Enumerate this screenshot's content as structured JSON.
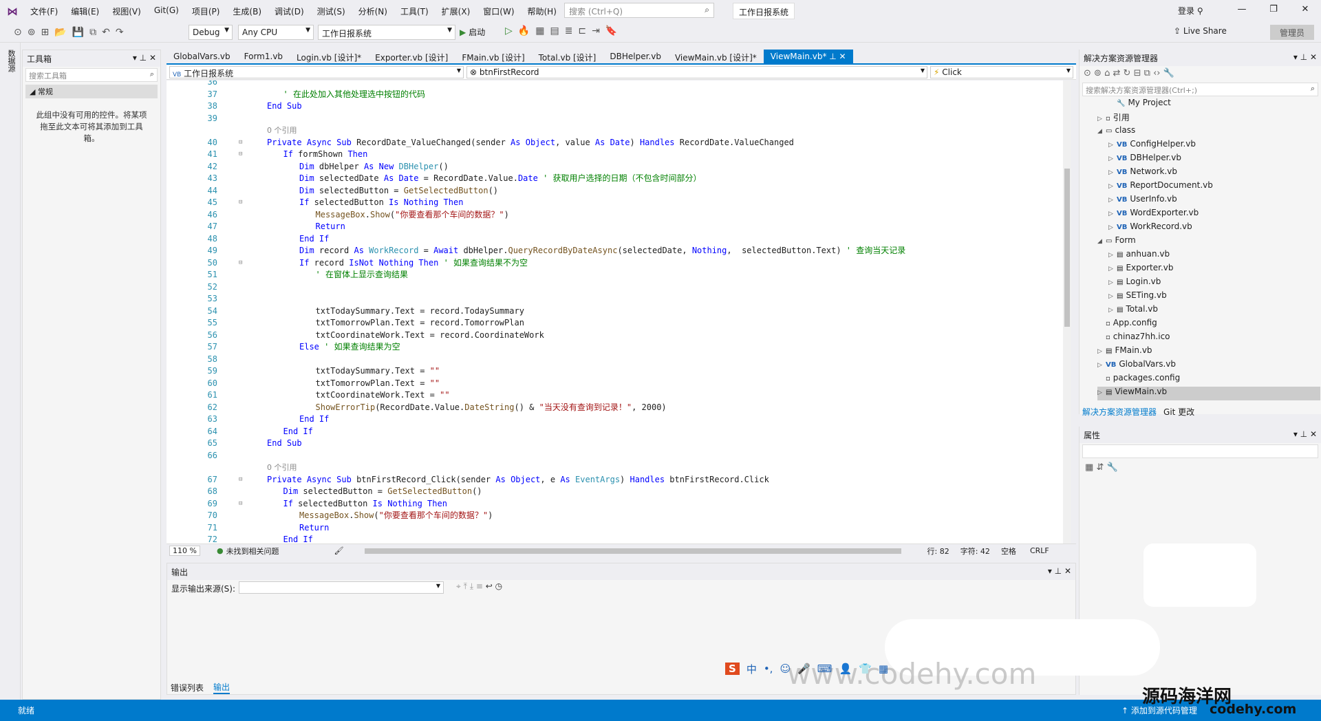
{
  "menubar": {
    "items": [
      "文件(F)",
      "编辑(E)",
      "视图(V)",
      "Git(G)",
      "项目(P)",
      "生成(B)",
      "调试(D)",
      "测试(S)",
      "分析(N)",
      "工具(T)",
      "扩展(X)",
      "窗口(W)",
      "帮助(H)"
    ],
    "search_placeholder": "搜索 (Ctrl+Q)",
    "app_title": "工作日报系统",
    "login": "登录"
  },
  "toolbar": {
    "config": "Debug",
    "platform": "Any CPU",
    "project": "工作日报系统",
    "start": "启动",
    "liveshare": "Live Share",
    "admin": "管理员"
  },
  "leftstrip": {
    "label": "数据源"
  },
  "toolbox": {
    "title": "工具箱",
    "search": "搜索工具箱",
    "group": "常规",
    "empty": "此组中没有可用的控件。将某项拖至此文本可将其添加到工具箱。"
  },
  "tabs": [
    "GlobalVars.vb",
    "Form1.vb",
    "Login.vb [设计]*",
    "Exporter.vb [设计]",
    "FMain.vb [设计]",
    "Total.vb [设计]",
    "DBHelper.vb",
    "ViewMain.vb [设计]*",
    "ViewMain.vb*"
  ],
  "navbar": {
    "project": "工作日报系统",
    "object": "btnFirstRecord",
    "event": "Click"
  },
  "code": [
    {
      "n": "36",
      "t": ""
    },
    {
      "n": "37",
      "t": "' 在此处加入其他处理选中按钮的代码",
      "cls": "cm",
      "indent": 2
    },
    {
      "n": "38",
      "t": "End Sub",
      "cls": "kw",
      "indent": 1
    },
    {
      "n": "39",
      "t": ""
    },
    {
      "ref": "0 个引用",
      "indent": 1
    },
    {
      "n": "40",
      "t": "Private Async Sub RecordDate_ValueChanged(sender As Object, value As Date) Handles RecordDate.ValueChanged",
      "indent": 1,
      "fold": true
    },
    {
      "n": "41",
      "t": "If formShown Then",
      "indent": 2,
      "fold": true
    },
    {
      "n": "42",
      "t": "Dim dbHelper As New DBHelper()",
      "indent": 3
    },
    {
      "n": "43",
      "t": "Dim selectedDate As Date = RecordDate.Value.Date ' 获取用户选择的日期（不包含时间部分）",
      "indent": 3
    },
    {
      "n": "44",
      "t": "Dim selectedButton = GetSelectedButton()",
      "indent": 3
    },
    {
      "n": "45",
      "t": "If selectedButton Is Nothing Then",
      "indent": 3,
      "fold": true
    },
    {
      "n": "46",
      "t": "MessageBox.Show(\"你要查看那个车间的数据？\")",
      "indent": 4
    },
    {
      "n": "47",
      "t": "Return",
      "indent": 4
    },
    {
      "n": "48",
      "t": "End If",
      "indent": 3
    },
    {
      "n": "49",
      "t": "Dim record As WorkRecord = Await dbHelper.QueryRecordByDateAsync(selectedDate, Nothing,  selectedButton.Text) ' 查询当天记录",
      "indent": 3
    },
    {
      "n": "50",
      "t": "If record IsNot Nothing Then ' 如果查询结果不为空",
      "indent": 3,
      "fold": true
    },
    {
      "n": "51",
      "t": "' 在窗体上显示查询结果",
      "cls": "cm",
      "indent": 4
    },
    {
      "n": "52",
      "t": ""
    },
    {
      "n": "53",
      "t": ""
    },
    {
      "n": "54",
      "t": "txtTodaySummary.Text = record.TodaySummary",
      "indent": 4
    },
    {
      "n": "55",
      "t": "txtTomorrowPlan.Text = record.TomorrowPlan",
      "indent": 4
    },
    {
      "n": "56",
      "t": "txtCoordinateWork.Text = record.CoordinateWork",
      "indent": 4
    },
    {
      "n": "57",
      "t": "Else ' 如果查询结果为空",
      "indent": 3
    },
    {
      "n": "58",
      "t": ""
    },
    {
      "n": "59",
      "t": "txtTodaySummary.Text = \"\"",
      "indent": 4
    },
    {
      "n": "60",
      "t": "txtTomorrowPlan.Text = \"\"",
      "indent": 4
    },
    {
      "n": "61",
      "t": "txtCoordinateWork.Text = \"\"",
      "indent": 4
    },
    {
      "n": "62",
      "t": "ShowErrorTip(RecordDate.Value.DateString() & \"当天没有查询到记录！\", 2000)",
      "indent": 4
    },
    {
      "n": "63",
      "t": "End If",
      "indent": 3
    },
    {
      "n": "64",
      "t": "End If",
      "indent": 2
    },
    {
      "n": "65",
      "t": "End Sub",
      "indent": 1
    },
    {
      "n": "66",
      "t": ""
    },
    {
      "ref": "0 个引用",
      "indent": 1
    },
    {
      "n": "67",
      "t": "Private Async Sub btnFirstRecord_Click(sender As Object, e As EventArgs) Handles btnFirstRecord.Click",
      "indent": 1,
      "fold": true
    },
    {
      "n": "68",
      "t": "Dim selectedButton = GetSelectedButton()",
      "indent": 2
    },
    {
      "n": "69",
      "t": "If selectedButton Is Nothing Then",
      "indent": 2,
      "fold": true
    },
    {
      "n": "70",
      "t": "MessageBox.Show(\"你要查看那个车间的数据？\")",
      "indent": 3
    },
    {
      "n": "71",
      "t": "Return",
      "indent": 3
    },
    {
      "n": "72",
      "t": "End If",
      "indent": 2
    }
  ],
  "editor_status": {
    "zoom": "110 %",
    "issues": "未找到相关问题",
    "line": "行: 82",
    "col": "字符: 42",
    "ws": "空格",
    "eol": "CRLF"
  },
  "output": {
    "title": "输出",
    "source_label": "显示输出来源(S):"
  },
  "bottom_tabs": [
    "错误列表",
    "输出"
  ],
  "solution": {
    "title": "解决方案资源管理器",
    "search": "搜索解决方案资源管理器(Ctrl+;)",
    "items": [
      {
        "label": "My Project",
        "depth": 2,
        "exp": "",
        "ico": "🔧"
      },
      {
        "label": "引用",
        "depth": 1,
        "exp": "▷",
        "ico": "▫"
      },
      {
        "label": "class",
        "depth": 1,
        "exp": "◢",
        "ico": "▭"
      },
      {
        "label": "ConfigHelper.vb",
        "depth": 2,
        "exp": "▷",
        "ico": "VB"
      },
      {
        "label": "DBHelper.vb",
        "depth": 2,
        "exp": "▷",
        "ico": "VB"
      },
      {
        "label": "Network.vb",
        "depth": 2,
        "exp": "▷",
        "ico": "VB"
      },
      {
        "label": "ReportDocument.vb",
        "depth": 2,
        "exp": "▷",
        "ico": "VB"
      },
      {
        "label": "UserInfo.vb",
        "depth": 2,
        "exp": "▷",
        "ico": "VB"
      },
      {
        "label": "WordExporter.vb",
        "depth": 2,
        "exp": "▷",
        "ico": "VB"
      },
      {
        "label": "WorkRecord.vb",
        "depth": 2,
        "exp": "▷",
        "ico": "VB"
      },
      {
        "label": "Form",
        "depth": 1,
        "exp": "◢",
        "ico": "▭"
      },
      {
        "label": "anhuan.vb",
        "depth": 2,
        "exp": "▷",
        "ico": "▤"
      },
      {
        "label": "Exporter.vb",
        "depth": 2,
        "exp": "▷",
        "ico": "▤"
      },
      {
        "label": "Login.vb",
        "depth": 2,
        "exp": "▷",
        "ico": "▤"
      },
      {
        "label": "SETing.vb",
        "depth": 2,
        "exp": "▷",
        "ico": "▤"
      },
      {
        "label": "Total.vb",
        "depth": 2,
        "exp": "▷",
        "ico": "▤"
      },
      {
        "label": "App.config",
        "depth": 1,
        "exp": "",
        "ico": "▫"
      },
      {
        "label": "chinaz7hh.ico",
        "depth": 1,
        "exp": "",
        "ico": "▫"
      },
      {
        "label": "FMain.vb",
        "depth": 1,
        "exp": "▷",
        "ico": "▤"
      },
      {
        "label": "GlobalVars.vb",
        "depth": 1,
        "exp": "▷",
        "ico": "VB"
      },
      {
        "label": "packages.config",
        "depth": 1,
        "exp": "",
        "ico": "▫"
      },
      {
        "label": "ViewMain.vb",
        "depth": 1,
        "exp": "▷",
        "ico": "▤"
      }
    ],
    "tabs": [
      "解决方案资源管理器",
      "Git 更改"
    ]
  },
  "properties": {
    "title": "属性"
  },
  "statusbar": {
    "ready": "就绪",
    "add_source": "添加到源代码管理"
  },
  "watermark": {
    "site": "www.codehy.com",
    "brand": "源码海洋网",
    "brand_suffix": "codehy.com"
  },
  "ime": {
    "lang": "中"
  }
}
